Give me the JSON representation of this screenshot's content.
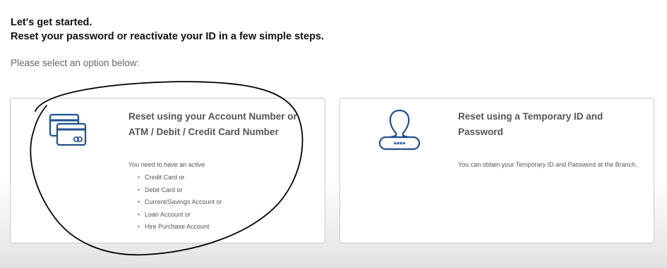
{
  "header": {
    "line1": "Let's get started.",
    "line2": "Reset your password or reactivate your ID in a few simple steps.",
    "instruction": "Please select an option below:"
  },
  "options": [
    {
      "icon": "card-icon",
      "title": "Reset using your Account Number or ATM / Debit / Credit Card Number",
      "description": "You need to have an active",
      "requirements": [
        "Credit Card or",
        "Debit Card or",
        "Current/Savings Account or",
        "Loan Account or",
        "Hire Purchase Account"
      ]
    },
    {
      "icon": "user-password-icon",
      "title": "Reset using a Temporary ID and Password",
      "description": "You can obtain your Temporary ID and Password at the Branch.",
      "icon_text": "****"
    }
  ],
  "colors": {
    "icon_blue": "#1d4f91",
    "border": "#c9c9c9",
    "text_gray": "#555555"
  }
}
